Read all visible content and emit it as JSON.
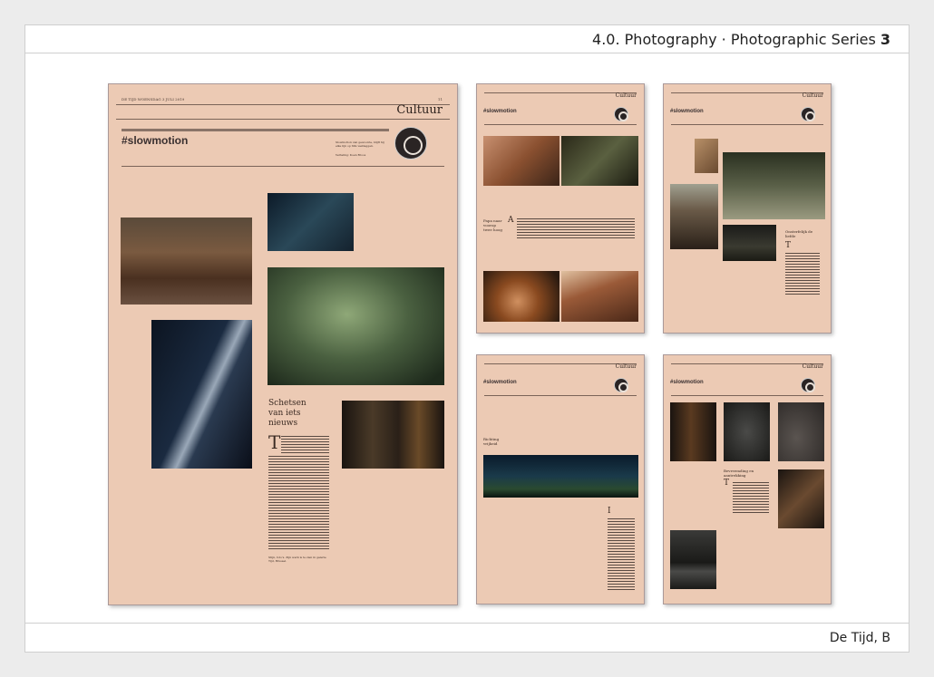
{
  "header": {
    "title": "4.0. Photography · Photographic Series",
    "number": "3"
  },
  "footer": {
    "credit": "De Tijd, B"
  },
  "large_page": {
    "dateline": "DE TIJD WOENSDAG 3 JULI 2019",
    "page_number": "11",
    "section": "Cultuur",
    "hashtag": "#slowmotion",
    "intro": "Slowmotion van gewoonte, blijft hij elke lijn op film vastleggen.",
    "byline": "Vertaling: Koen Broos",
    "headline": "Schetsen van iets nieuws",
    "dropcap": "T",
    "signoff": "Stijn, foto's. Zijn werk is te zien in galerie Tijd, Brussel."
  },
  "small_pages": [
    {
      "section": "Cultuur",
      "hashtag": "#slowmotion",
      "headline": "Papa naar voorop twee hoog",
      "dropcap": "A"
    },
    {
      "section": "Cultuur",
      "hashtag": "#slowmotion",
      "headline": "Onsterfelijk de liefde",
      "dropcap": "T"
    },
    {
      "section": "Cultuur",
      "hashtag": "#slowmotion",
      "headline": "Richting vrijheid",
      "dropcap": "I"
    },
    {
      "section": "Cultuur",
      "hashtag": "#slowmotion",
      "headline": "Bevreemding en aantrekking",
      "dropcap": "T"
    }
  ]
}
